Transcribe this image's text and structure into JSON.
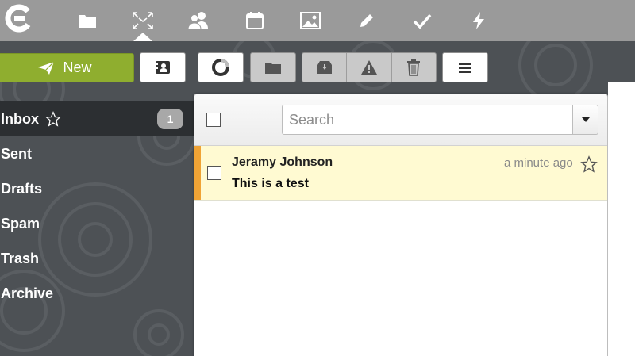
{
  "topbar": {
    "apps": [
      {
        "icon": "folder-icon"
      },
      {
        "icon": "mail-icon",
        "active": true
      },
      {
        "icon": "contacts-icon"
      },
      {
        "icon": "calendar-icon"
      },
      {
        "icon": "image-icon"
      },
      {
        "icon": "pencil-icon"
      },
      {
        "icon": "checkmark-icon"
      },
      {
        "icon": "lightning-icon"
      }
    ]
  },
  "toolbar": {
    "new_label": "New"
  },
  "sidebar": {
    "folders": [
      {
        "label": "Inbox",
        "badge": "1"
      },
      {
        "label": "Sent"
      },
      {
        "label": "Drafts"
      },
      {
        "label": "Spam"
      },
      {
        "label": "Trash"
      },
      {
        "label": "Archive"
      }
    ]
  },
  "search": {
    "placeholder": "Search"
  },
  "messages": [
    {
      "sender": "Jeramy Johnson",
      "subject": "This is a test",
      "time": "a minute ago",
      "unread": true
    }
  ],
  "colors": {
    "topbar": "#9a9a9a",
    "new_button": "#8fae2f",
    "unread_row": "#fffad2",
    "unread_marker": "#f0a335",
    "sidebar_active": "#2c2f32"
  }
}
